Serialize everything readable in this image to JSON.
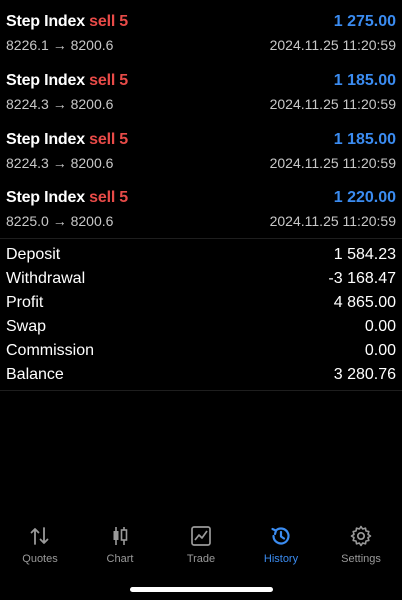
{
  "trades": [
    {
      "symbol": "Step Index",
      "direction": "sell 5",
      "profit": "1 275.00",
      "prices": "8226.1 → 8200.6",
      "time": "2024.11.25 11:20:59"
    },
    {
      "symbol": "Step Index",
      "direction": "sell 5",
      "profit": "1 185.00",
      "prices": "8224.3 → 8200.6",
      "time": "2024.11.25 11:20:59"
    },
    {
      "symbol": "Step Index",
      "direction": "sell 5",
      "profit": "1 185.00",
      "prices": "8224.3 → 8200.6",
      "time": "2024.11.25 11:20:59"
    },
    {
      "symbol": "Step Index",
      "direction": "sell 5",
      "profit": "1 220.00",
      "prices": "8225.0 → 8200.6",
      "time": "2024.11.25 11:20:59"
    }
  ],
  "summary": [
    {
      "label": "Deposit",
      "value": "1 584.23"
    },
    {
      "label": "Withdrawal",
      "value": "-3 168.47"
    },
    {
      "label": "Profit",
      "value": "4 865.00"
    },
    {
      "label": "Swap",
      "value": "0.00"
    },
    {
      "label": "Commission",
      "value": "0.00"
    },
    {
      "label": "Balance",
      "value": "3 280.76"
    }
  ],
  "tabs": [
    {
      "label": "Quotes",
      "icon": "quotes-icon"
    },
    {
      "label": "Chart",
      "icon": "candlestick-icon"
    },
    {
      "label": "Trade",
      "icon": "trade-chart-icon"
    },
    {
      "label": "History",
      "icon": "history-icon"
    },
    {
      "label": "Settings",
      "icon": "gear-icon"
    }
  ],
  "active_tab": "History",
  "colors": {
    "profit": "#3b8cf1",
    "sell": "#e84b48",
    "active_tab": "#3b8cf1",
    "inactive_tab": "#9a9a9a"
  }
}
